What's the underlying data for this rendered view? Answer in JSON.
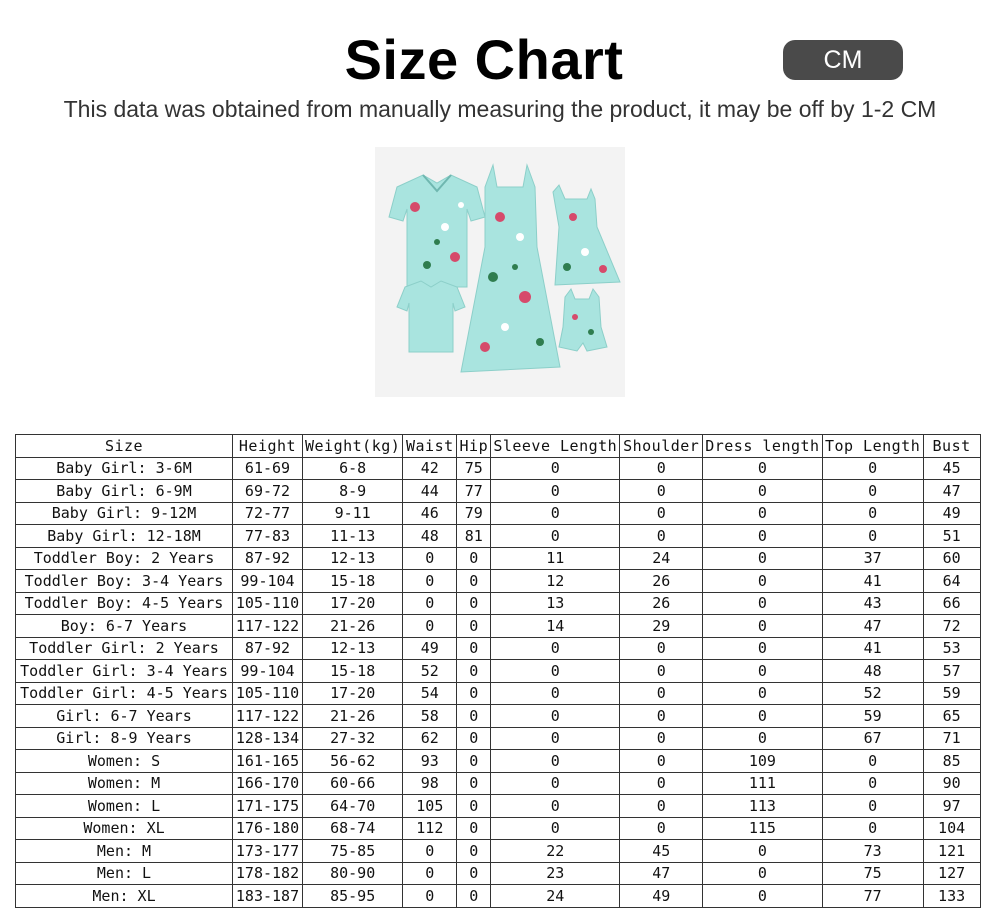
{
  "header": {
    "title": "Size Chart",
    "unit": "CM",
    "note": "This data was obtained from manually measuring the product, it may be off by 1-2 CM"
  },
  "colors": {
    "badge_bg": "#4a4a4a",
    "fabric": "#a9e4df",
    "photo_bg": "#f3f3f3"
  },
  "table": {
    "columns": [
      "Size",
      "Height",
      "Weight(kg)",
      "Waist",
      "Hip",
      "Sleeve Length",
      "Shoulder",
      "Dress length",
      "Top Length",
      "Bust"
    ],
    "rows": [
      [
        "Baby Girl: 3-6M",
        "61-69",
        "6-8",
        "42",
        "75",
        "0",
        "0",
        "0",
        "0",
        "45"
      ],
      [
        "Baby Girl: 6-9M",
        "69-72",
        "8-9",
        "44",
        "77",
        "0",
        "0",
        "0",
        "0",
        "47"
      ],
      [
        "Baby Girl: 9-12M",
        "72-77",
        "9-11",
        "46",
        "79",
        "0",
        "0",
        "0",
        "0",
        "49"
      ],
      [
        "Baby Girl: 12-18M",
        "77-83",
        "11-13",
        "48",
        "81",
        "0",
        "0",
        "0",
        "0",
        "51"
      ],
      [
        "Toddler Boy: 2 Years",
        "87-92",
        "12-13",
        "0",
        "0",
        "11",
        "24",
        "0",
        "37",
        "60"
      ],
      [
        "Toddler Boy: 3-4 Years",
        "99-104",
        "15-18",
        "0",
        "0",
        "12",
        "26",
        "0",
        "41",
        "64"
      ],
      [
        "Toddler Boy: 4-5 Years",
        "105-110",
        "17-20",
        "0",
        "0",
        "13",
        "26",
        "0",
        "43",
        "66"
      ],
      [
        "Boy: 6-7 Years",
        "117-122",
        "21-26",
        "0",
        "0",
        "14",
        "29",
        "0",
        "47",
        "72"
      ],
      [
        "Toddler Girl: 2 Years",
        "87-92",
        "12-13",
        "49",
        "0",
        "0",
        "0",
        "0",
        "41",
        "53"
      ],
      [
        "Toddler Girl: 3-4 Years",
        "99-104",
        "15-18",
        "52",
        "0",
        "0",
        "0",
        "0",
        "48",
        "57"
      ],
      [
        "Toddler Girl: 4-5 Years",
        "105-110",
        "17-20",
        "54",
        "0",
        "0",
        "0",
        "0",
        "52",
        "59"
      ],
      [
        "Girl: 6-7 Years",
        "117-122",
        "21-26",
        "58",
        "0",
        "0",
        "0",
        "0",
        "59",
        "65"
      ],
      [
        "Girl: 8-9 Years",
        "128-134",
        "27-32",
        "62",
        "0",
        "0",
        "0",
        "0",
        "67",
        "71"
      ],
      [
        "Women: S",
        "161-165",
        "56-62",
        "93",
        "0",
        "0",
        "0",
        "109",
        "0",
        "85"
      ],
      [
        "Women: M",
        "166-170",
        "60-66",
        "98",
        "0",
        "0",
        "0",
        "111",
        "0",
        "90"
      ],
      [
        "Women: L",
        "171-175",
        "64-70",
        "105",
        "0",
        "0",
        "0",
        "113",
        "0",
        "97"
      ],
      [
        "Women: XL",
        "176-180",
        "68-74",
        "112",
        "0",
        "0",
        "0",
        "115",
        "0",
        "104"
      ],
      [
        "Men: M",
        "173-177",
        "75-85",
        "0",
        "0",
        "22",
        "45",
        "0",
        "73",
        "121"
      ],
      [
        "Men: L",
        "178-182",
        "80-90",
        "0",
        "0",
        "23",
        "47",
        "0",
        "75",
        "127"
      ],
      [
        "Men: XL",
        "183-187",
        "85-95",
        "0",
        "0",
        "24",
        "49",
        "0",
        "77",
        "133"
      ]
    ]
  }
}
